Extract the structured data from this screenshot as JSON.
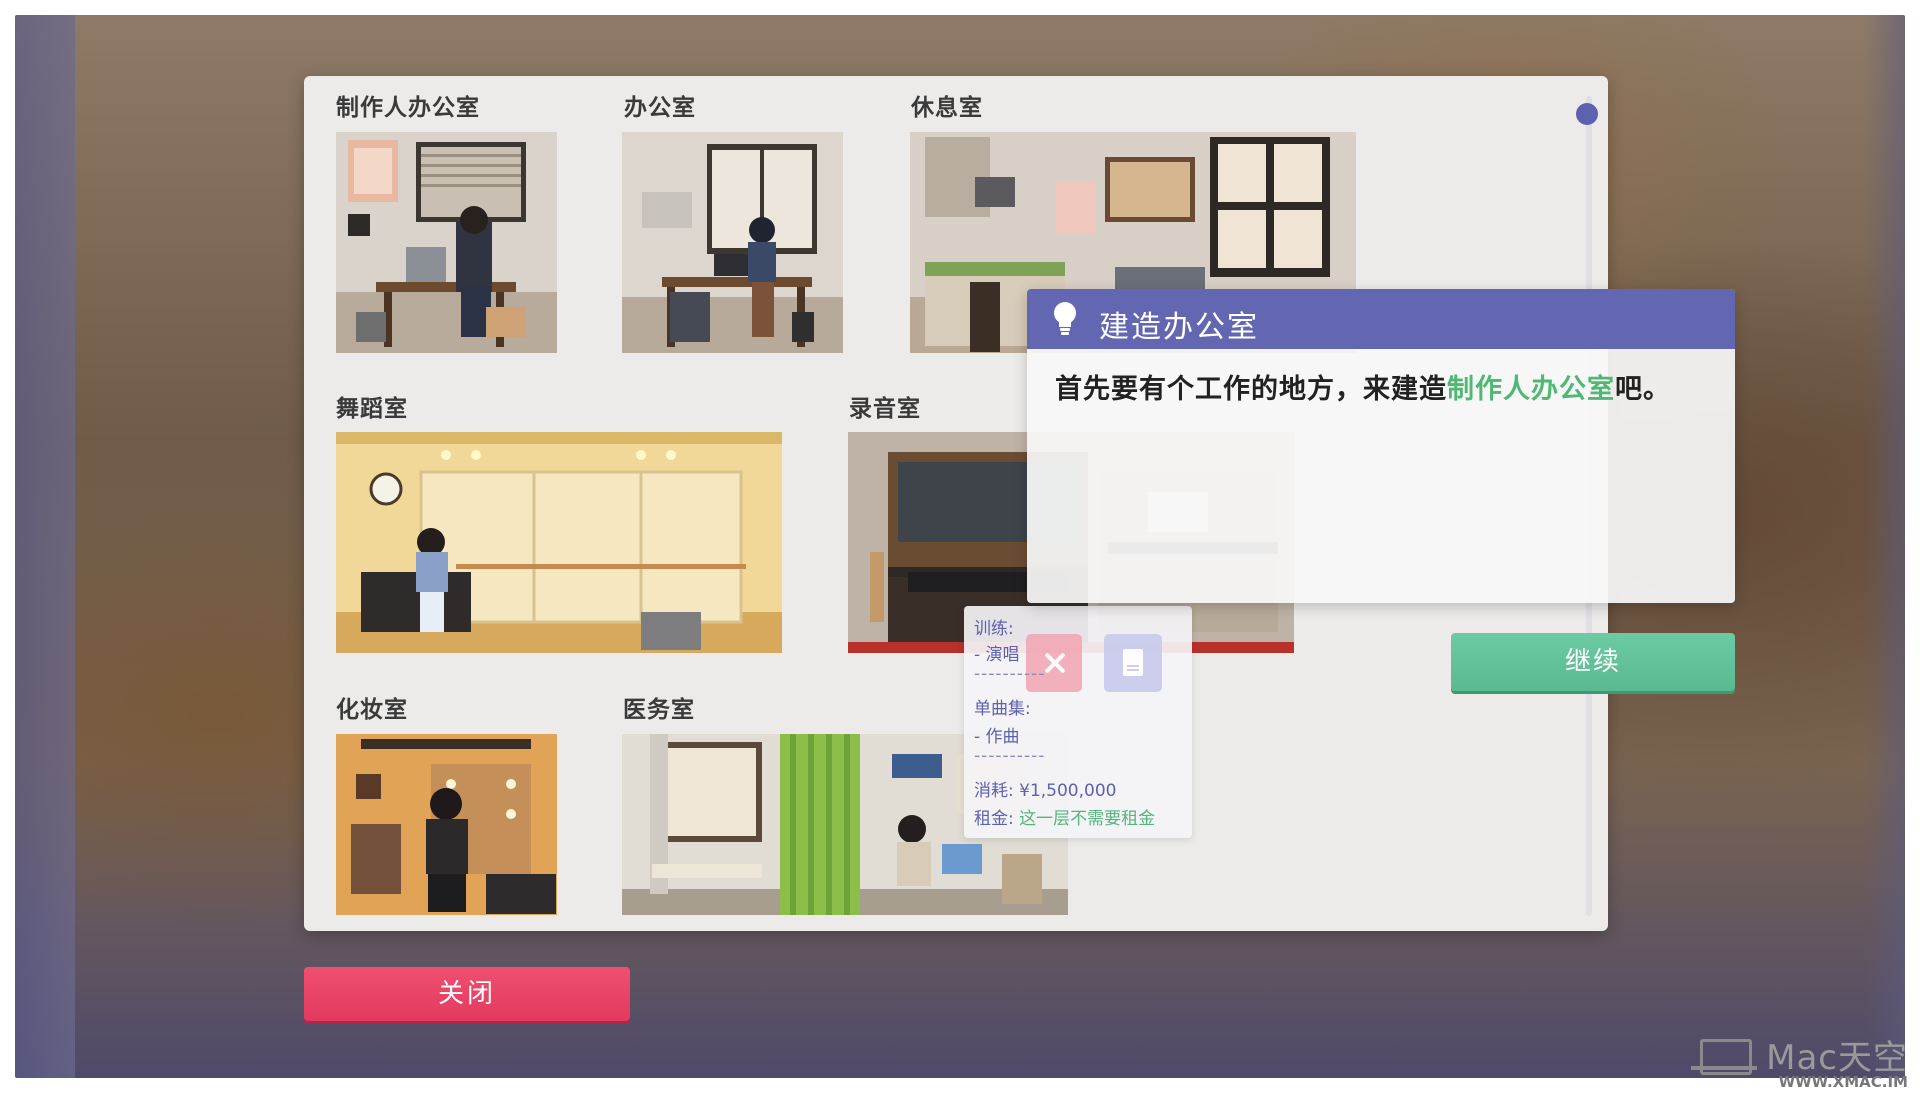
{
  "rooms": {
    "producer_office": "制作人办公室",
    "office": "办公室",
    "lounge": "休息室",
    "dance_room": "舞蹈室",
    "recording_room": "录音室",
    "makeup_room": "化妆室",
    "medical_room": "医务室"
  },
  "hover_card": {
    "training_label": "训练:",
    "training_item": "- 演唱",
    "separator": "----------",
    "single_label": "单曲集:",
    "single_item": "- 作曲",
    "cost_label": "消耗:",
    "cost_value": "¥1,500,000",
    "rent_label": "租金:",
    "rent_value": "这一层不需要租金"
  },
  "dialog": {
    "title": "建造办公室",
    "text_before": "首先要有个工作的地方，来建造",
    "text_highlight": "制作人办公室",
    "text_after": "吧。"
  },
  "buttons": {
    "continue": "继续",
    "close": "关闭"
  },
  "watermark": {
    "main": "Mac天空",
    "sub": "WWW.XMAC.IM"
  },
  "colors": {
    "dialog_header": "#6366b0",
    "highlight_green": "#4fb973",
    "continue_button": "#5ab98f",
    "close_button": "#e23a5f",
    "scroll_thumb": "#5e61b0"
  }
}
